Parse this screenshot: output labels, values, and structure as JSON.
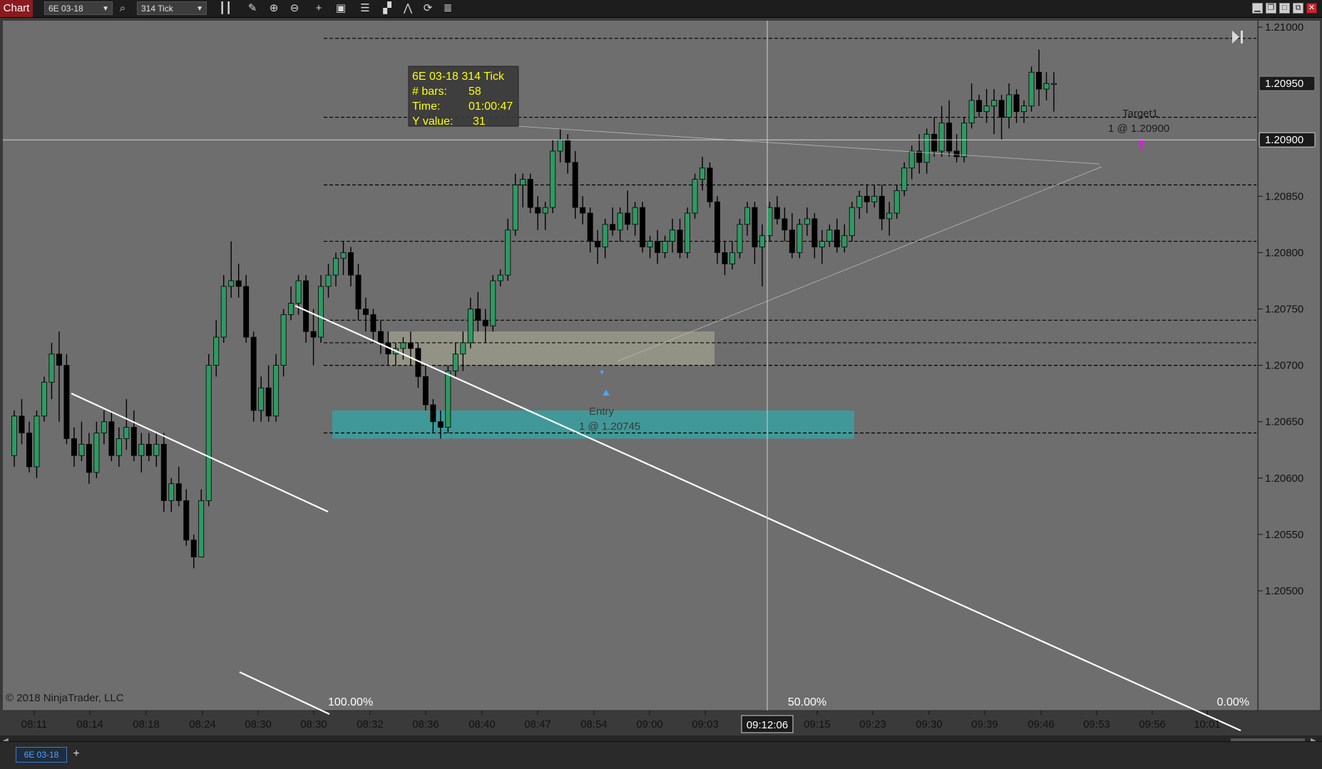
{
  "toolbar": {
    "chart_label": "Chart",
    "instrument": "6E 03-18",
    "interval": "314 Tick",
    "icons": [
      "search-icon",
      "bar-style-icon",
      "pencil-icon",
      "zoom-in-icon",
      "zoom-out-icon",
      "crosshair-icon",
      "data-box-icon",
      "strategy-icon",
      "indicator-icon",
      "draw-tools-icon",
      "refresh-icon",
      "properties-icon"
    ],
    "window_buttons": [
      "minimize",
      "restore",
      "maximize",
      "close"
    ]
  },
  "tabs": {
    "active": "6E 03-18",
    "add_label": "+"
  },
  "colors": {
    "background": "#6e6e6e",
    "up_candle": "#2e9a62",
    "down_candle": "#000000",
    "entry_zone": "#a0a08e",
    "support_zone": "#3aa0a0",
    "tooltip_text": "#ffff00"
  },
  "chart_data": {
    "type": "candlestick",
    "instrument": "6E 03-18",
    "interval": "314 Tick",
    "y_axis": {
      "ylim": [
        1.205,
        1.2102
      ],
      "ticks": [
        "1.21000",
        "1.20950",
        "1.20900",
        "1.20850",
        "1.20800",
        "1.20750",
        "1.20700",
        "1.20650",
        "1.20600",
        "1.20550",
        "1.20500"
      ],
      "highlighted_labels": [
        "1.20950",
        "1.20900"
      ]
    },
    "x_axis": {
      "ticks": [
        "08:11",
        "08:14",
        "08:18",
        "08:24",
        "08:30",
        "08:30",
        "08:32",
        "08:36",
        "08:40",
        "08:47",
        "08:54",
        "09:00",
        "09:03",
        "09:15",
        "09:23",
        "09:30",
        "09:39",
        "09:46",
        "09:53",
        "09:56",
        "10:01"
      ],
      "crosshair_time": "09:12:06"
    },
    "horizontal_levels": [
      1.2099,
      1.2092,
      1.2086,
      1.2081,
      1.2074,
      1.2072,
      1.207,
      1.2064
    ],
    "entry_zone": {
      "y_top": 1.2073,
      "y_bottom": 1.207,
      "label_line1": "Entry",
      "label_line2": "1 @ 1.20745"
    },
    "support_zone": {
      "y_top": 1.2066,
      "y_bottom": 1.20635
    },
    "target": {
      "label_line1": "Target1",
      "label_line2": "1 @ 1.20900",
      "price": 1.209
    },
    "crosshair_price_label": "1.20900",
    "current_price_label": "1.20950",
    "fib_labels": [
      "100.00%",
      "50.00%",
      "0.00%"
    ],
    "tooltip": {
      "title": "6E 03-18 314 Tick",
      "rows": [
        {
          "label": "# bars:",
          "value": "58"
        },
        {
          "label": "Time:",
          "value": "01:00:47"
        },
        {
          "label": "Y value:",
          "value": "31"
        }
      ]
    },
    "copyright": "© 2018 NinjaTrader, LLC",
    "candles": [
      {
        "o": 1.2062,
        "h": 1.2066,
        "l": 1.2061,
        "c": 1.20655
      },
      {
        "o": 1.20655,
        "h": 1.2067,
        "l": 1.2063,
        "c": 1.2064
      },
      {
        "o": 1.2064,
        "h": 1.2065,
        "l": 1.20605,
        "c": 1.2061
      },
      {
        "o": 1.2061,
        "h": 1.2066,
        "l": 1.206,
        "c": 1.20655
      },
      {
        "o": 1.20655,
        "h": 1.2069,
        "l": 1.2065,
        "c": 1.20685
      },
      {
        "o": 1.20685,
        "h": 1.2072,
        "l": 1.2067,
        "c": 1.2071
      },
      {
        "o": 1.2071,
        "h": 1.2073,
        "l": 1.2065,
        "c": 1.207
      },
      {
        "o": 1.207,
        "h": 1.2071,
        "l": 1.2063,
        "c": 1.20635
      },
      {
        "o": 1.20635,
        "h": 1.20645,
        "l": 1.2061,
        "c": 1.2062
      },
      {
        "o": 1.2062,
        "h": 1.2065,
        "l": 1.20615,
        "c": 1.2063
      },
      {
        "o": 1.2063,
        "h": 1.2064,
        "l": 1.20595,
        "c": 1.20605
      },
      {
        "o": 1.20605,
        "h": 1.2065,
        "l": 1.206,
        "c": 1.2064
      },
      {
        "o": 1.2064,
        "h": 1.2066,
        "l": 1.2063,
        "c": 1.2065
      },
      {
        "o": 1.2065,
        "h": 1.2066,
        "l": 1.20615,
        "c": 1.2062
      },
      {
        "o": 1.2062,
        "h": 1.20645,
        "l": 1.2061,
        "c": 1.20635
      },
      {
        "o": 1.20635,
        "h": 1.2067,
        "l": 1.20625,
        "c": 1.20645
      },
      {
        "o": 1.20645,
        "h": 1.2066,
        "l": 1.20615,
        "c": 1.2062
      },
      {
        "o": 1.2062,
        "h": 1.2064,
        "l": 1.20605,
        "c": 1.2063
      },
      {
        "o": 1.2063,
        "h": 1.2064,
        "l": 1.20615,
        "c": 1.2062
      },
      {
        "o": 1.2062,
        "h": 1.2064,
        "l": 1.2061,
        "c": 1.2063
      },
      {
        "o": 1.2063,
        "h": 1.2064,
        "l": 1.2057,
        "c": 1.2058
      },
      {
        "o": 1.2058,
        "h": 1.206,
        "l": 1.2057,
        "c": 1.20595
      },
      {
        "o": 1.20595,
        "h": 1.2061,
        "l": 1.20575,
        "c": 1.2058
      },
      {
        "o": 1.2058,
        "h": 1.2059,
        "l": 1.2054,
        "c": 1.20545
      },
      {
        "o": 1.20545,
        "h": 1.2055,
        "l": 1.2052,
        "c": 1.2053
      },
      {
        "o": 1.2053,
        "h": 1.2059,
        "l": 1.2053,
        "c": 1.2058
      },
      {
        "o": 1.2058,
        "h": 1.2071,
        "l": 1.20575,
        "c": 1.207
      },
      {
        "o": 1.207,
        "h": 1.2074,
        "l": 1.2069,
        "c": 1.20725
      },
      {
        "o": 1.20725,
        "h": 1.2078,
        "l": 1.2072,
        "c": 1.2077
      },
      {
        "o": 1.2077,
        "h": 1.2081,
        "l": 1.2076,
        "c": 1.20775
      },
      {
        "o": 1.20775,
        "h": 1.2079,
        "l": 1.2076,
        "c": 1.2077
      },
      {
        "o": 1.2077,
        "h": 1.2078,
        "l": 1.2072,
        "c": 1.20725
      },
      {
        "o": 1.20725,
        "h": 1.2073,
        "l": 1.2065,
        "c": 1.2066
      },
      {
        "o": 1.2066,
        "h": 1.2069,
        "l": 1.2065,
        "c": 1.2068
      },
      {
        "o": 1.2068,
        "h": 1.207,
        "l": 1.2065,
        "c": 1.20655
      },
      {
        "o": 1.20655,
        "h": 1.2071,
        "l": 1.2065,
        "c": 1.207
      },
      {
        "o": 1.207,
        "h": 1.2075,
        "l": 1.2069,
        "c": 1.20745
      },
      {
        "o": 1.20745,
        "h": 1.2077,
        "l": 1.2074,
        "c": 1.20755
      },
      {
        "o": 1.20755,
        "h": 1.2078,
        "l": 1.20745,
        "c": 1.20775
      },
      {
        "o": 1.20775,
        "h": 1.2078,
        "l": 1.2072,
        "c": 1.2073
      },
      {
        "o": 1.2073,
        "h": 1.2075,
        "l": 1.207,
        "c": 1.20725
      },
      {
        "o": 1.20725,
        "h": 1.2078,
        "l": 1.2072,
        "c": 1.2077
      },
      {
        "o": 1.2077,
        "h": 1.2079,
        "l": 1.2076,
        "c": 1.2078
      },
      {
        "o": 1.2078,
        "h": 1.208,
        "l": 1.2077,
        "c": 1.20795
      },
      {
        "o": 1.20795,
        "h": 1.2081,
        "l": 1.2078,
        "c": 1.208
      },
      {
        "o": 1.208,
        "h": 1.20805,
        "l": 1.2077,
        "c": 1.2078
      },
      {
        "o": 1.2078,
        "h": 1.2079,
        "l": 1.2074,
        "c": 1.2075
      },
      {
        "o": 1.2075,
        "h": 1.2076,
        "l": 1.2073,
        "c": 1.20745
      },
      {
        "o": 1.20745,
        "h": 1.2075,
        "l": 1.2072,
        "c": 1.2073
      },
      {
        "o": 1.2073,
        "h": 1.2074,
        "l": 1.2071,
        "c": 1.2072
      },
      {
        "o": 1.2072,
        "h": 1.2073,
        "l": 1.207,
        "c": 1.2071
      },
      {
        "o": 1.2071,
        "h": 1.2072,
        "l": 1.207,
        "c": 1.20715
      },
      {
        "o": 1.20715,
        "h": 1.20725,
        "l": 1.20705,
        "c": 1.2072
      },
      {
        "o": 1.2072,
        "h": 1.2073,
        "l": 1.207,
        "c": 1.20715
      },
      {
        "o": 1.20715,
        "h": 1.2072,
        "l": 1.2068,
        "c": 1.2069
      },
      {
        "o": 1.2069,
        "h": 1.207,
        "l": 1.2066,
        "c": 1.20665
      },
      {
        "o": 1.20665,
        "h": 1.2067,
        "l": 1.2064,
        "c": 1.2065
      },
      {
        "o": 1.2065,
        "h": 1.2066,
        "l": 1.20635,
        "c": 1.20645
      },
      {
        "o": 1.20645,
        "h": 1.207,
        "l": 1.2064,
        "c": 1.20695
      },
      {
        "o": 1.20695,
        "h": 1.2072,
        "l": 1.2069,
        "c": 1.2071
      },
      {
        "o": 1.2071,
        "h": 1.2073,
        "l": 1.20695,
        "c": 1.2072
      },
      {
        "o": 1.2072,
        "h": 1.2076,
        "l": 1.20715,
        "c": 1.2075
      },
      {
        "o": 1.2075,
        "h": 1.20765,
        "l": 1.2073,
        "c": 1.2074
      },
      {
        "o": 1.2074,
        "h": 1.2075,
        "l": 1.2072,
        "c": 1.20735
      },
      {
        "o": 1.20735,
        "h": 1.2078,
        "l": 1.2073,
        "c": 1.20775
      },
      {
        "o": 1.20775,
        "h": 1.20785,
        "l": 1.2077,
        "c": 1.2078
      },
      {
        "o": 1.2078,
        "h": 1.2083,
        "l": 1.20775,
        "c": 1.2082
      },
      {
        "o": 1.2082,
        "h": 1.2087,
        "l": 1.20815,
        "c": 1.2086
      },
      {
        "o": 1.2086,
        "h": 1.2087,
        "l": 1.2084,
        "c": 1.20865
      },
      {
        "o": 1.20865,
        "h": 1.2087,
        "l": 1.20835,
        "c": 1.2084
      },
      {
        "o": 1.2084,
        "h": 1.2085,
        "l": 1.2082,
        "c": 1.20835
      },
      {
        "o": 1.20835,
        "h": 1.20845,
        "l": 1.2082,
        "c": 1.2084
      },
      {
        "o": 1.2084,
        "h": 1.209,
        "l": 1.20835,
        "c": 1.2089
      },
      {
        "o": 1.2089,
        "h": 1.2091,
        "l": 1.2088,
        "c": 1.209
      },
      {
        "o": 1.209,
        "h": 1.20905,
        "l": 1.2087,
        "c": 1.2088
      },
      {
        "o": 1.2088,
        "h": 1.2089,
        "l": 1.2083,
        "c": 1.2084
      },
      {
        "o": 1.2084,
        "h": 1.2085,
        "l": 1.20825,
        "c": 1.20835
      },
      {
        "o": 1.20835,
        "h": 1.2084,
        "l": 1.208,
        "c": 1.2081
      },
      {
        "o": 1.2081,
        "h": 1.2082,
        "l": 1.2079,
        "c": 1.20805
      },
      {
        "o": 1.20805,
        "h": 1.2083,
        "l": 1.20795,
        "c": 1.20825
      },
      {
        "o": 1.20825,
        "h": 1.2084,
        "l": 1.20815,
        "c": 1.2082
      },
      {
        "o": 1.2082,
        "h": 1.2084,
        "l": 1.2081,
        "c": 1.20835
      },
      {
        "o": 1.20835,
        "h": 1.20855,
        "l": 1.2082,
        "c": 1.20825
      },
      {
        "o": 1.20825,
        "h": 1.20845,
        "l": 1.20815,
        "c": 1.2084
      },
      {
        "o": 1.2084,
        "h": 1.20845,
        "l": 1.208,
        "c": 1.20805
      },
      {
        "o": 1.20805,
        "h": 1.20815,
        "l": 1.20795,
        "c": 1.2081
      },
      {
        "o": 1.2081,
        "h": 1.2082,
        "l": 1.2079,
        "c": 1.208
      },
      {
        "o": 1.208,
        "h": 1.20815,
        "l": 1.20795,
        "c": 1.2081
      },
      {
        "o": 1.2081,
        "h": 1.2083,
        "l": 1.208,
        "c": 1.2082
      },
      {
        "o": 1.2082,
        "h": 1.2083,
        "l": 1.20795,
        "c": 1.208
      },
      {
        "o": 1.208,
        "h": 1.2084,
        "l": 1.20795,
        "c": 1.20835
      },
      {
        "o": 1.20835,
        "h": 1.2087,
        "l": 1.2083,
        "c": 1.20865
      },
      {
        "o": 1.20865,
        "h": 1.20885,
        "l": 1.20855,
        "c": 1.20875
      },
      {
        "o": 1.20875,
        "h": 1.2088,
        "l": 1.2084,
        "c": 1.20845
      },
      {
        "o": 1.20845,
        "h": 1.2085,
        "l": 1.2079,
        "c": 1.208
      },
      {
        "o": 1.208,
        "h": 1.2081,
        "l": 1.2078,
        "c": 1.2079
      },
      {
        "o": 1.2079,
        "h": 1.2081,
        "l": 1.20785,
        "c": 1.208
      },
      {
        "o": 1.208,
        "h": 1.2083,
        "l": 1.20795,
        "c": 1.20825
      },
      {
        "o": 1.20825,
        "h": 1.20845,
        "l": 1.20815,
        "c": 1.2084
      },
      {
        "o": 1.2084,
        "h": 1.20845,
        "l": 1.2079,
        "c": 1.20805
      },
      {
        "o": 1.20805,
        "h": 1.20825,
        "l": 1.2077,
        "c": 1.20815
      },
      {
        "o": 1.20815,
        "h": 1.20845,
        "l": 1.2081,
        "c": 1.2084
      },
      {
        "o": 1.2084,
        "h": 1.2085,
        "l": 1.20825,
        "c": 1.2083
      },
      {
        "o": 1.2083,
        "h": 1.2084,
        "l": 1.2081,
        "c": 1.2082
      },
      {
        "o": 1.2082,
        "h": 1.20835,
        "l": 1.20795,
        "c": 1.208
      },
      {
        "o": 1.208,
        "h": 1.2083,
        "l": 1.20795,
        "c": 1.20825
      },
      {
        "o": 1.20825,
        "h": 1.2084,
        "l": 1.20815,
        "c": 1.2083
      },
      {
        "o": 1.2083,
        "h": 1.20835,
        "l": 1.20795,
        "c": 1.20805
      },
      {
        "o": 1.20805,
        "h": 1.2082,
        "l": 1.2079,
        "c": 1.2081
      },
      {
        "o": 1.2081,
        "h": 1.20825,
        "l": 1.20805,
        "c": 1.2082
      },
      {
        "o": 1.2082,
        "h": 1.2083,
        "l": 1.208,
        "c": 1.20805
      },
      {
        "o": 1.20805,
        "h": 1.20825,
        "l": 1.208,
        "c": 1.20815
      },
      {
        "o": 1.20815,
        "h": 1.20845,
        "l": 1.2081,
        "c": 1.2084
      },
      {
        "o": 1.2084,
        "h": 1.20855,
        "l": 1.2083,
        "c": 1.2085
      },
      {
        "o": 1.2085,
        "h": 1.2086,
        "l": 1.20835,
        "c": 1.20845
      },
      {
        "o": 1.20845,
        "h": 1.2086,
        "l": 1.2084,
        "c": 1.2085
      },
      {
        "o": 1.2085,
        "h": 1.2086,
        "l": 1.2082,
        "c": 1.2083
      },
      {
        "o": 1.2083,
        "h": 1.20845,
        "l": 1.20815,
        "c": 1.20835
      },
      {
        "o": 1.20835,
        "h": 1.2086,
        "l": 1.2083,
        "c": 1.20855
      },
      {
        "o": 1.20855,
        "h": 1.2088,
        "l": 1.2085,
        "c": 1.20875
      },
      {
        "o": 1.20875,
        "h": 1.20895,
        "l": 1.20865,
        "c": 1.2089
      },
      {
        "o": 1.2089,
        "h": 1.20905,
        "l": 1.2087,
        "c": 1.2088
      },
      {
        "o": 1.2088,
        "h": 1.2091,
        "l": 1.2087,
        "c": 1.20905
      },
      {
        "o": 1.20905,
        "h": 1.2092,
        "l": 1.20885,
        "c": 1.2089
      },
      {
        "o": 1.2089,
        "h": 1.2093,
        "l": 1.20885,
        "c": 1.20915
      },
      {
        "o": 1.20915,
        "h": 1.20935,
        "l": 1.20885,
        "c": 1.2089
      },
      {
        "o": 1.2089,
        "h": 1.20905,
        "l": 1.2088,
        "c": 1.20885
      },
      {
        "o": 1.20885,
        "h": 1.2092,
        "l": 1.2088,
        "c": 1.20915
      },
      {
        "o": 1.20915,
        "h": 1.2095,
        "l": 1.2091,
        "c": 1.20935
      },
      {
        "o": 1.20935,
        "h": 1.2094,
        "l": 1.2092,
        "c": 1.20925
      },
      {
        "o": 1.20925,
        "h": 1.20945,
        "l": 1.20915,
        "c": 1.2093
      },
      {
        "o": 1.2093,
        "h": 1.20945,
        "l": 1.20905,
        "c": 1.20935
      },
      {
        "o": 1.20935,
        "h": 1.2094,
        "l": 1.209,
        "c": 1.2092
      },
      {
        "o": 1.2092,
        "h": 1.2095,
        "l": 1.2091,
        "c": 1.2094
      },
      {
        "o": 1.2094,
        "h": 1.20945,
        "l": 1.20915,
        "c": 1.20925
      },
      {
        "o": 1.20925,
        "h": 1.20935,
        "l": 1.20915,
        "c": 1.2093
      },
      {
        "o": 1.2093,
        "h": 1.20965,
        "l": 1.20925,
        "c": 1.2096
      },
      {
        "o": 1.2096,
        "h": 1.2098,
        "l": 1.2093,
        "c": 1.20945
      },
      {
        "o": 1.20945,
        "h": 1.2096,
        "l": 1.20935,
        "c": 1.2095
      },
      {
        "o": 1.2095,
        "h": 1.2096,
        "l": 1.20925,
        "c": 1.2095
      }
    ]
  }
}
